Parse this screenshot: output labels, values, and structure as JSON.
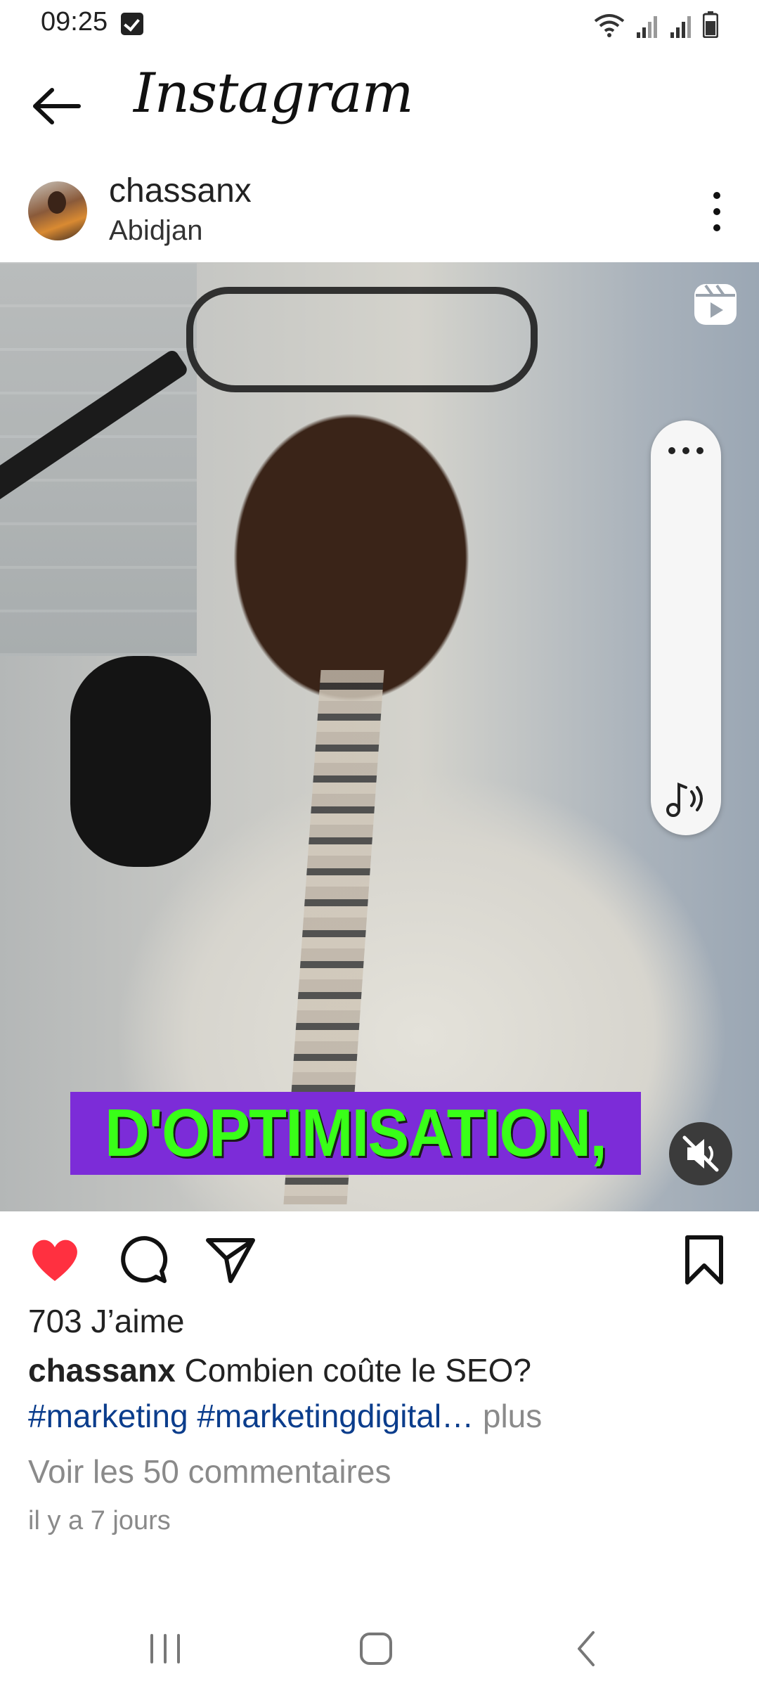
{
  "status_bar": {
    "time": "09:25"
  },
  "header": {
    "app_title": "Instagram"
  },
  "post": {
    "username": "chassanx",
    "location": "Abidjan",
    "video_caption_overlay": "D'OPTIMISATION,",
    "likes": "703 J’aime",
    "caption_username": "chassanx",
    "caption_text": "Combien coûte le SEO?",
    "hashtags": "#marketing #marketingdigital…",
    "more_label": "plus",
    "view_comments": "Voir les 50 commentaires",
    "time_ago": "il y a 7 jours"
  },
  "colors": {
    "like_red": "#ff3040",
    "hashtag_blue": "#0b3d8c",
    "caption_banner": "#7c2cd8",
    "caption_text": "#39ff18"
  },
  "icons": [
    "checkbox-icon",
    "wifi-icon",
    "signal-icon",
    "battery-icon",
    "back-arrow-icon",
    "more-vertical-icon",
    "reels-icon",
    "more-horizontal-icon",
    "audio-icon",
    "muted-icon",
    "heart-icon",
    "comment-icon",
    "share-icon",
    "bookmark-icon",
    "recents-icon",
    "home-icon",
    "nav-back-icon"
  ]
}
